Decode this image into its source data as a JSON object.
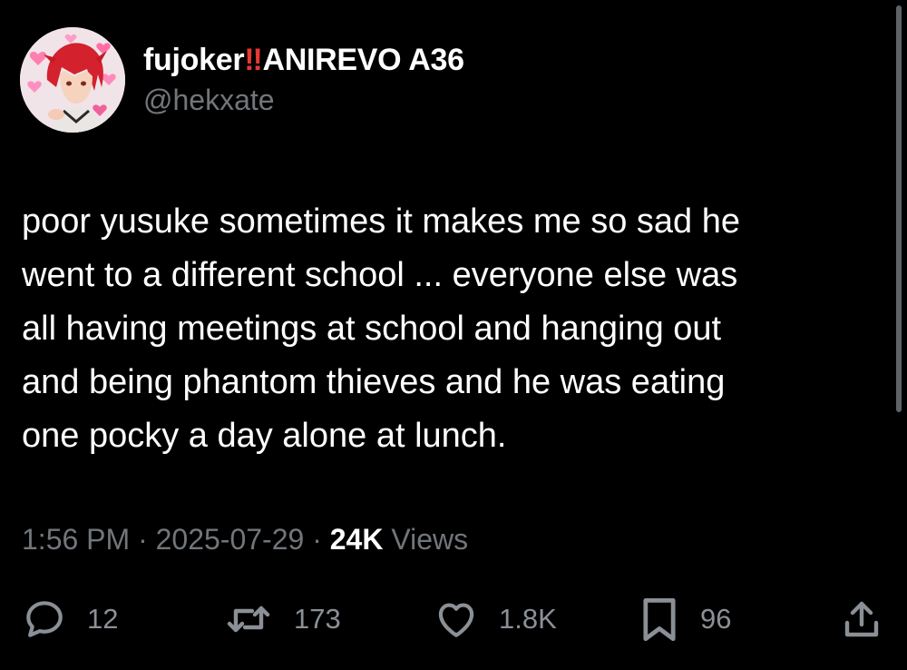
{
  "author": {
    "display_name": "fujoker",
    "emoji": "‼",
    "display_name_suffix": "ANIREVO A36",
    "handle": "@hekxate"
  },
  "tweet": {
    "text": "poor yusuke sometimes it makes me so sad he\nwent to a different school ... everyone else was\nall having meetings at school and hanging out\nand being phantom thieves and he was eating\none pocky a day alone at lunch."
  },
  "meta": {
    "time": "1:56 PM",
    "separator": " · ",
    "date": "2025-07-29",
    "views_count": "24K",
    "views_label": "Views"
  },
  "actions": {
    "replies": "12",
    "reposts": "173",
    "likes": "1.8K",
    "bookmarks": "96"
  },
  "icons": {
    "reply": "reply-icon",
    "repost": "repost-icon",
    "like": "heart-icon",
    "bookmark": "bookmark-icon",
    "share": "share-icon"
  },
  "colors": {
    "background": "#000000",
    "primary_text": "#ffffff",
    "secondary_text": "#71767b",
    "emoji_red": "#e53935"
  }
}
